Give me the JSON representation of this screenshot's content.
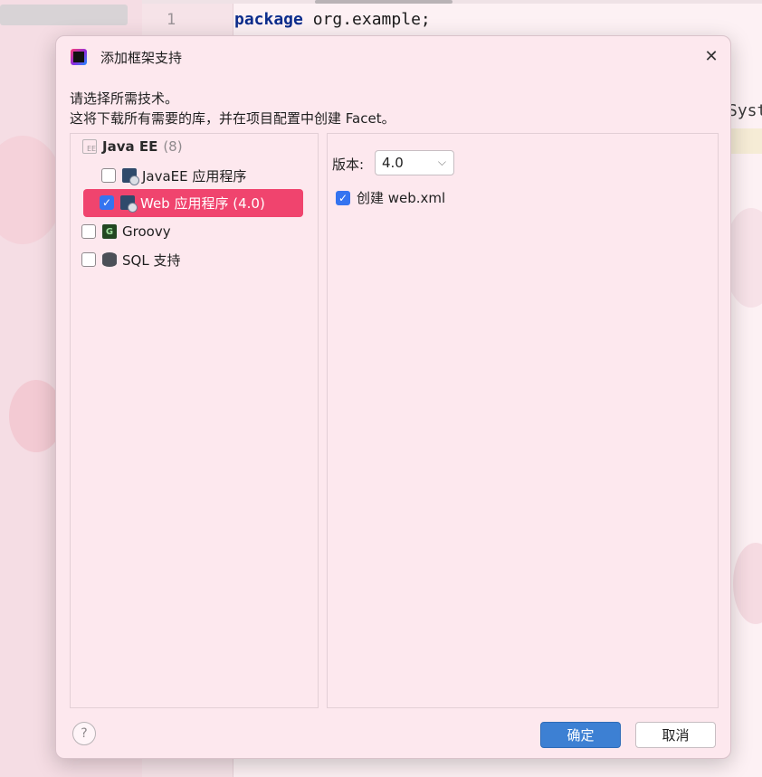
{
  "ide": {
    "line_number": "1",
    "code_keyword": "package",
    "code_rest": " org.example;",
    "code_fragment": "Syst"
  },
  "dialog": {
    "title": "添加框架支持",
    "close_icon": "close-icon",
    "hint_line1": "请选择所需技术。",
    "hint_line2": "这将下载所有需要的库，并在项目配置中创建 Facet。",
    "tree": {
      "group_label": "Java EE",
      "group_count": "(8)",
      "items": [
        {
          "label": "JavaEE 应用程序",
          "checked": false,
          "icon": "javaee-app-icon"
        },
        {
          "label": "Web 应用程序 (4.0)",
          "checked": true,
          "icon": "web-app-icon",
          "selected": true
        },
        {
          "label": "Groovy",
          "checked": false,
          "icon": "groovy-icon"
        },
        {
          "label": "SQL 支持",
          "checked": false,
          "icon": "sql-database-icon"
        }
      ]
    },
    "settings": {
      "version_label": "版本:",
      "version_value": "4.0",
      "create_label": "创建 web.xml",
      "create_checked": true
    },
    "footer": {
      "help": "?",
      "ok_label": "确定",
      "cancel_label": "取消"
    },
    "colors": {
      "accent_selection": "#f0446e",
      "primary_button": "#3d80d3",
      "checkbox_checked": "#3574f0"
    }
  }
}
